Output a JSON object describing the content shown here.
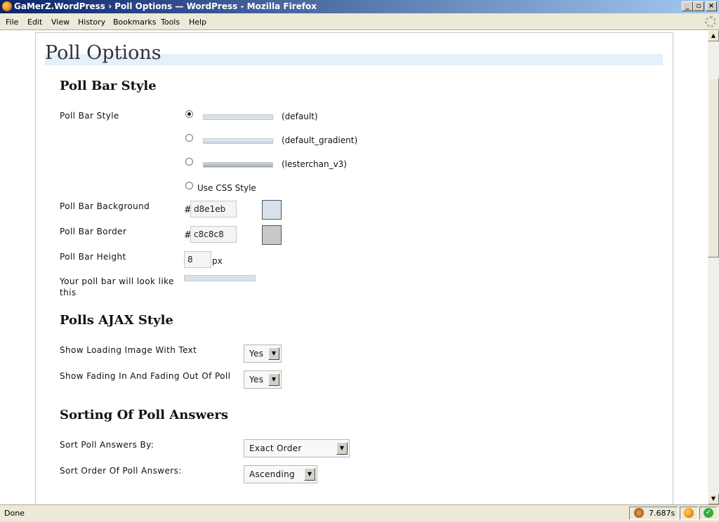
{
  "window": {
    "title": "GaMerZ.WordPress › Poll Options — WordPress - Mozilla Firefox",
    "buttons": {
      "minimize": "_",
      "maximize": "▫",
      "close": "×"
    }
  },
  "menu": [
    "File",
    "Edit",
    "View",
    "History",
    "Bookmarks",
    "Tools",
    "Help"
  ],
  "page": {
    "title": "Poll Options",
    "sections": {
      "bar_style": {
        "heading": "Poll Bar Style",
        "style_label": "Poll Bar Style",
        "options": [
          {
            "label": "(default)",
            "checked": true
          },
          {
            "label": "(default_gradient)",
            "checked": false
          },
          {
            "label": "(lesterchan_v3)",
            "checked": false
          },
          {
            "label": "Use CSS Style",
            "checked": false
          }
        ],
        "background_label": "Poll Bar Background",
        "background_value": "d8e1eb",
        "border_label": "Poll Bar Border",
        "border_value": "c8c8c8",
        "height_label": "Poll Bar Height",
        "height_value": "8",
        "height_unit": "px",
        "preview_label": "Your poll bar will look like this",
        "hash": "#"
      },
      "ajax": {
        "heading": "Polls AJAX Style",
        "loading_label": "Show Loading Image With Text",
        "loading_value": "Yes",
        "fading_label": "Show Fading In And Fading Out Of Poll",
        "fading_value": "Yes"
      },
      "sorting": {
        "heading": "Sorting Of Poll Answers",
        "sort_by_label": "Sort Poll Answers By:",
        "sort_by_value": "Exact Order",
        "sort_order_label": "Sort Order Of Poll Answers:",
        "sort_order_value": "Ascending"
      }
    }
  },
  "colors": {
    "bar_background": "#d8e1eb",
    "bar_border": "#c8c8c8",
    "title_highlight": "#e4f0fb"
  },
  "status": {
    "text": "Done",
    "load_time": "7.687s"
  }
}
